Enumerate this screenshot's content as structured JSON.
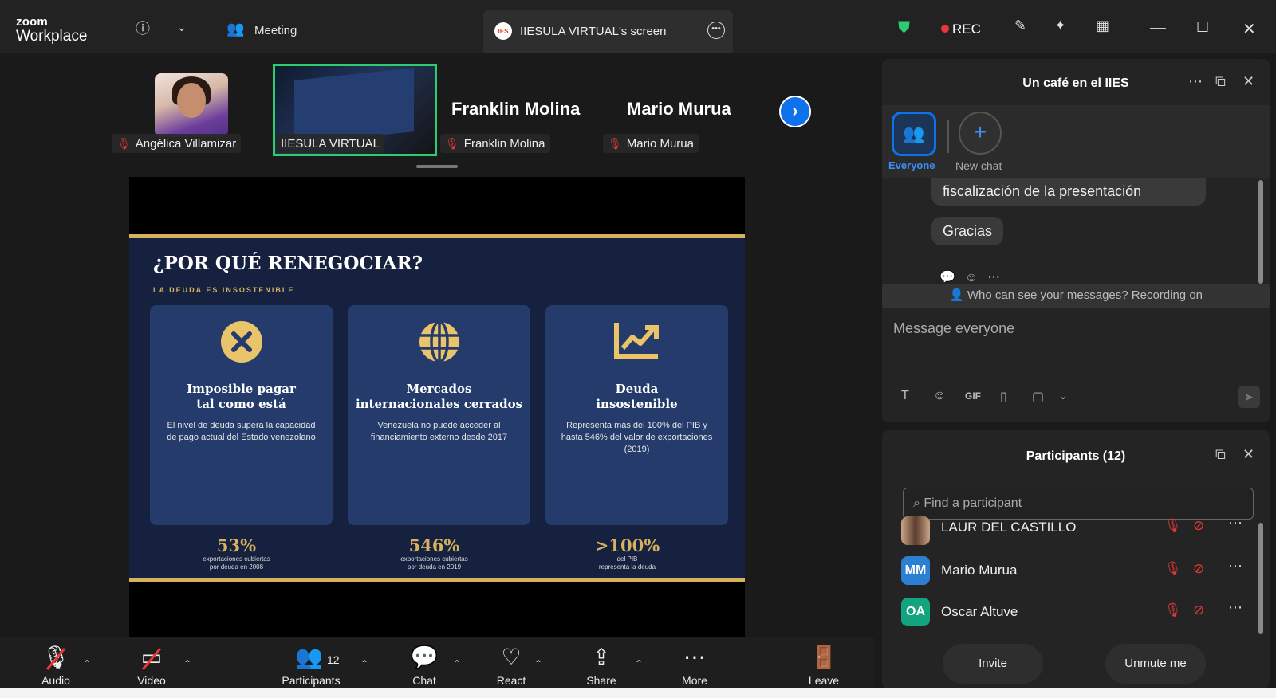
{
  "titlebar": {
    "logo_top": "zoom",
    "logo_bottom": "Workplace",
    "meeting_label": "Meeting",
    "screen_tab_label": "IIESULA VIRTUAL's screen",
    "screen_tab_logo": "IES",
    "rec_label": "REC"
  },
  "thumbnails": [
    {
      "name": "Angélica Villamizar"
    },
    {
      "name": "IIESULA VIRTUAL"
    },
    {
      "name": "Franklin Molina",
      "big_name": "Franklin Molina"
    },
    {
      "name": "Mario Murua",
      "big_name": "Mario Murua"
    }
  ],
  "slide": {
    "title": "¿POR QUÉ RENEGOCIAR?",
    "subtitle": "LA DEUDA ES INSOSTENIBLE",
    "cards": [
      {
        "icon": "x-circle-icon",
        "title": "Imposible pagar\ntal como está",
        "desc": "El nivel de deuda supera la capacidad de pago actual del Estado venezolano"
      },
      {
        "icon": "globe-icon",
        "title": "Mercados\ninternacionales cerrados",
        "desc": "Venezuela no puede acceder al financiamiento externo desde 2017"
      },
      {
        "icon": "trend-chart-icon",
        "title": "Deuda\ninsostenible",
        "desc": "Representa más del 100% del PIB y hasta 546% del valor de exportaciones (2019)"
      }
    ],
    "stats": [
      {
        "value": "53%",
        "label1": "exportaciones cubiertas",
        "label2": "por deuda en 2008"
      },
      {
        "value": "546%",
        "label1": "exportaciones cubiertas",
        "label2": "por deuda en 2019"
      },
      {
        "value": ">100%",
        "label1": "del PIB",
        "label2": "representa la deuda"
      }
    ],
    "accent_color": "#d6b15e",
    "background_color": "#15213f",
    "card_color": "#243b6b"
  },
  "toolbar": {
    "audio": "Audio",
    "video": "Video",
    "participants": "Participants",
    "participants_count": "12",
    "chat": "Chat",
    "react": "React",
    "share": "Share",
    "more": "More",
    "leave": "Leave"
  },
  "chat": {
    "title": "Un café en el IIES",
    "everyone_label": "Everyone",
    "new_chat_label": "New chat",
    "messages": [
      {
        "text": "fiscalización de la presentación"
      },
      {
        "text": "Gracias"
      }
    ],
    "notice": "Who can see your messages? Recording on",
    "composer_placeholder": "Message everyone",
    "gif_label": "GIF"
  },
  "participants": {
    "title": "Participants (12)",
    "search_placeholder": "Find a participant",
    "list": [
      {
        "name": "LAUR DEL CASTILLO",
        "initials": "",
        "avatar_color": "#8a6a50"
      },
      {
        "name": "Mario Murua",
        "initials": "MM",
        "avatar_color": "#2d7fd3"
      },
      {
        "name": "Oscar Altuve",
        "initials": "OA",
        "avatar_color": "#12a37f"
      }
    ],
    "invite_label": "Invite",
    "unmute_label": "Unmute me"
  }
}
